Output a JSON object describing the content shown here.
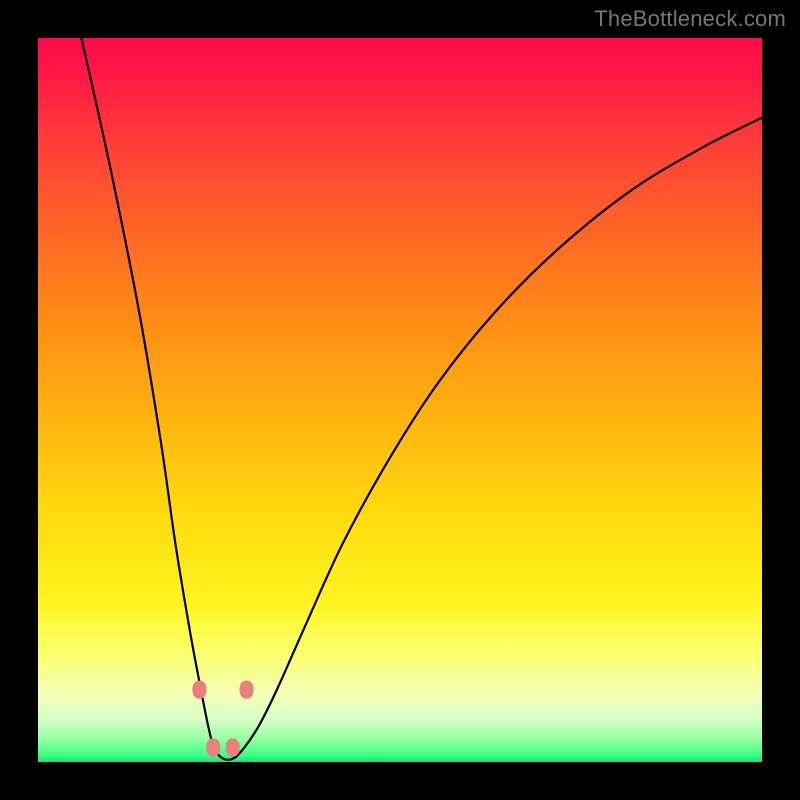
{
  "watermark": "TheBottleneck.com",
  "colors": {
    "frame": "#000000",
    "watermark_text": "#777777",
    "curve_stroke": "#000000",
    "marker_fill": "#e98080",
    "gradient_top": "#ff0a4a",
    "gradient_bottom": "#14e27a"
  },
  "chart_data": {
    "type": "line",
    "title": "",
    "xlabel": "",
    "ylabel": "",
    "xlim": [
      0,
      100
    ],
    "ylim": [
      0,
      100
    ],
    "grid": false,
    "legend": false,
    "note": "V-shaped bottleneck curve over vertical red→green gradient. Axes are unlabeled; values estimated from pixel positions on a 0–100 normalized grid. y=0 bottom (green), y=100 top (red).",
    "series": [
      {
        "name": "bottleneck-curve",
        "x": [
          6,
          10,
          14,
          17,
          19,
          21,
          22.5,
          23.5,
          24.3,
          25.5,
          27,
          28.5,
          30.5,
          33,
          37,
          42,
          48,
          55,
          63,
          72,
          82,
          92,
          100
        ],
        "y": [
          100,
          82,
          62,
          44,
          30,
          18,
          10,
          5,
          2,
          0.5,
          0.5,
          2,
          5,
          10,
          19,
          30,
          41,
          52,
          62,
          71,
          79,
          85,
          89
        ]
      }
    ],
    "markers": {
      "name": "highlight-dots",
      "x": [
        22.3,
        24.2,
        26.9,
        28.8
      ],
      "y": [
        10.0,
        2.0,
        2.0,
        10.0
      ]
    }
  }
}
